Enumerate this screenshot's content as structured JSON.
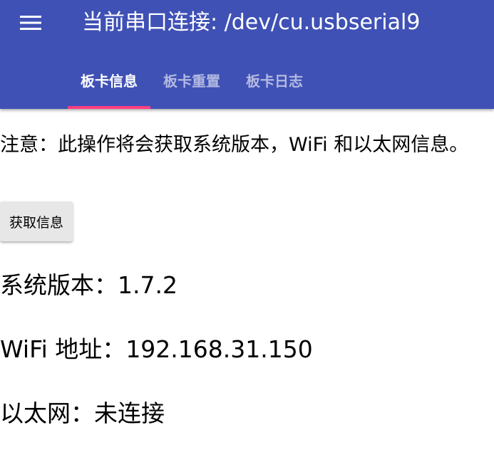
{
  "header": {
    "menu_icon": "hamburger-menu-icon",
    "title": "当前串口连接: /dev/cu.usbserial9",
    "background_color": "#3f51b5",
    "tabs": [
      {
        "label": "板卡信息",
        "active": true
      },
      {
        "label": "板卡重置",
        "active": false
      },
      {
        "label": "板卡日志",
        "active": false
      }
    ],
    "indicator_color": "#ff4081"
  },
  "main": {
    "notice": "注意：此操作将会获取系统版本，WiFi 和以太网信息。",
    "fetch_button_label": "获取信息",
    "info": {
      "system_version_label": "系统版本：",
      "system_version_value": "1.7.2",
      "wifi_label": "WiFi 地址：",
      "wifi_value": "192.168.31.150",
      "ethernet_label": "以太网：",
      "ethernet_value": "未连接"
    }
  }
}
